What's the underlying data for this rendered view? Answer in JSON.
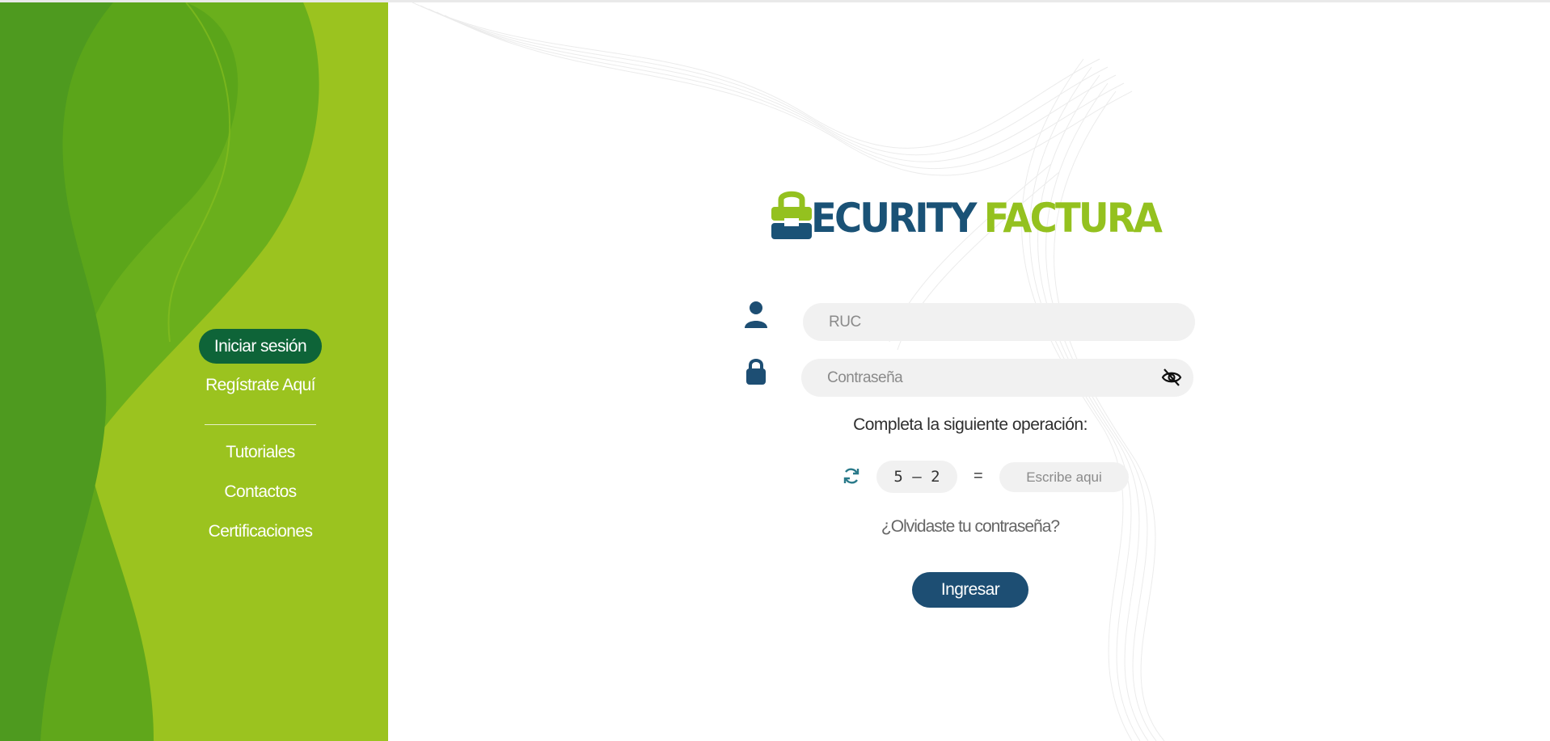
{
  "sidebar": {
    "items": [
      {
        "label": "Iniciar sesión",
        "active": true
      },
      {
        "label": "Regístrate Aquí"
      }
    ],
    "secondary_items": [
      {
        "label": "Tutoriales"
      },
      {
        "label": "Contactos"
      },
      {
        "label": "Certificaciones"
      }
    ]
  },
  "logo": {
    "word1": "ECURITY",
    "word2": "FACTURA"
  },
  "form": {
    "ruc_placeholder": "RUC",
    "password_placeholder": "Contraseña",
    "operation_label": "Completa la siguiente operación:",
    "captcha": {
      "operation": "5 – 2",
      "equals": "=",
      "answer_placeholder": "Escribe aqui"
    },
    "forgot_password": "¿Olvidaste tu contraseña?",
    "submit_label": "Ingresar"
  },
  "icons": {
    "user": "user-icon",
    "lock": "lock-icon",
    "eye": "eye-off-icon",
    "refresh": "refresh-icon"
  },
  "colors": {
    "sidebar_green": "#9bc31f",
    "sidebar_dark_green": "#4e9a1f",
    "active_pill": "#0e6438",
    "brand_blue": "#1a5276",
    "brand_green": "#94c11f",
    "button_blue": "#1d4e73",
    "field_bg": "#f1f1f1"
  }
}
